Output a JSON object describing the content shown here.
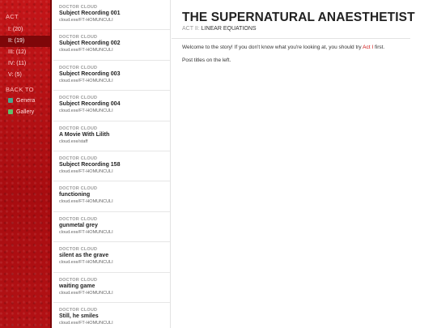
{
  "sidebar": {
    "act_heading": "ACT",
    "acts": [
      {
        "label": "I: (20)",
        "active": false
      },
      {
        "label": "II: (19)",
        "active": true
      },
      {
        "label": "III: (12)",
        "active": false
      },
      {
        "label": "IV: (11)",
        "active": false
      },
      {
        "label": "V: (5)",
        "active": false
      }
    ],
    "back_heading": "BACK TO",
    "back_links": [
      {
        "label": "Genera",
        "color": "#47a88f"
      },
      {
        "label": "Gallery",
        "color": "#5fbf6a"
      }
    ]
  },
  "posts": [
    {
      "author": "DOCTOR CLOUD",
      "title": "Subject Recording 001",
      "source": "cloud.exe/FT-HOMUNCULI"
    },
    {
      "author": "DOCTOR CLOUD",
      "title": "Subject Recording 002",
      "source": "cloud.exe/FT-HOMUNCULI"
    },
    {
      "author": "DOCTOR CLOUD",
      "title": "Subject Recording 003",
      "source": "cloud.exe/FT-HOMUNCULI"
    },
    {
      "author": "DOCTOR CLOUD",
      "title": "Subject Recording 004",
      "source": "cloud.exe/FT-HOMUNCULI"
    },
    {
      "author": "DOCTOR CLOUD",
      "title": "A Movie With Lilith",
      "source": "cloud.exe/staff"
    },
    {
      "author": "DOCTOR CLOUD",
      "title": "Subject Recording 158",
      "source": "cloud.exe/FT-HOMUNCULI"
    },
    {
      "author": "DOCTOR CLOUD",
      "title": "functioning",
      "source": "cloud.exe/FT-HOMUNCULI"
    },
    {
      "author": "DOCTOR CLOUD",
      "title": "gunmetal grey",
      "source": "cloud.exe/FT-HOMUNCULI"
    },
    {
      "author": "DOCTOR CLOUD",
      "title": "silent as the grave",
      "source": "cloud.exe/FT-HOMUNCULI"
    },
    {
      "author": "DOCTOR CLOUD",
      "title": "waiting game",
      "source": "cloud.exe/FT-HOMUNCULI"
    },
    {
      "author": "DOCTOR CLOUD",
      "title": "Still, he smiles",
      "source": "cloud.exe/FT-HOMUNCULI"
    }
  ],
  "main": {
    "title": "THE SUPERNATURAL ANAESTHETIST",
    "act_label": "ACT II:",
    "act_name": "LINEAR EQUATIONS",
    "intro_before": "Welcome to the story! If you don't know what you're looking at, you should try ",
    "intro_link": "Act I",
    "intro_after": " first.",
    "hint": "Post titles on the left."
  }
}
